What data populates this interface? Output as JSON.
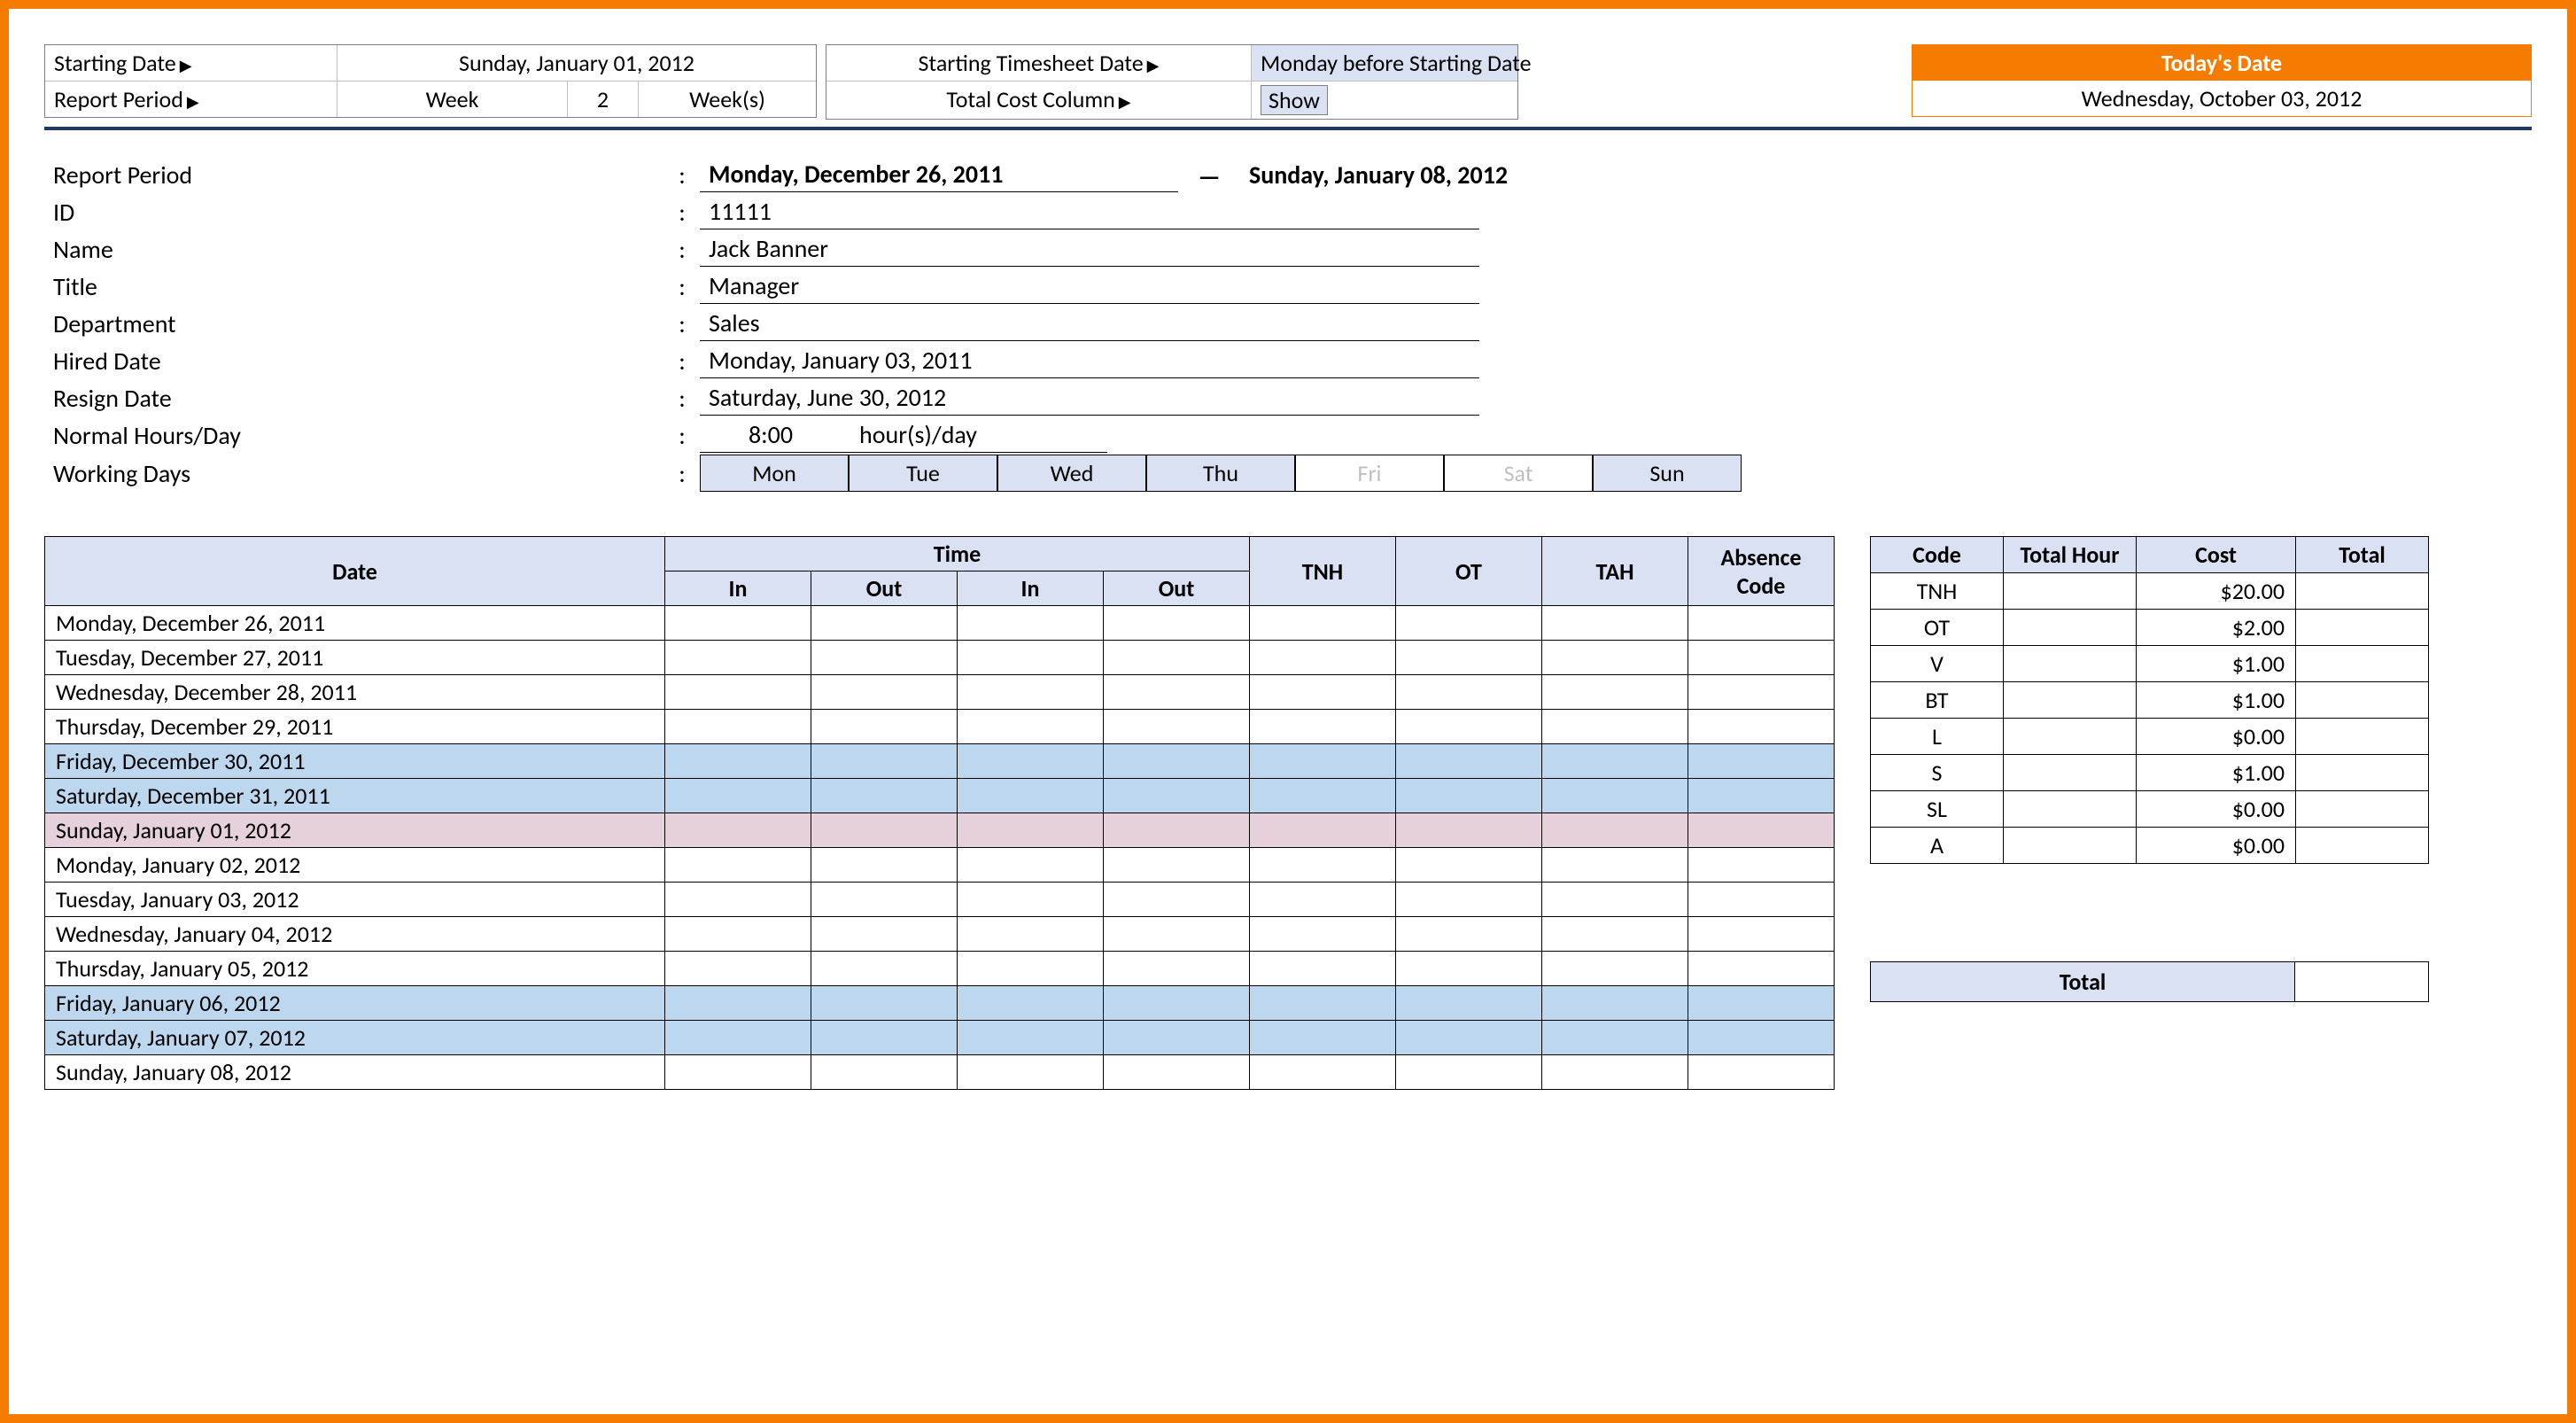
{
  "topbar": {
    "starting_date_label": "Starting Date",
    "starting_date_value": "Sunday, January 01, 2012",
    "report_period_label": "Report Period",
    "report_period_unit": "Week",
    "report_period_number": "2",
    "report_period_suffix": "Week(s)",
    "starting_ts_label": "Starting Timesheet Date",
    "starting_ts_value": "Monday before Starting Date",
    "total_cost_label": "Total Cost Column",
    "total_cost_value": "Show"
  },
  "today": {
    "heading": "Today's Date",
    "value": "Wednesday, October 03, 2012"
  },
  "info": {
    "report_period_lbl": "Report Period",
    "period_start": "Monday, December 26, 2011",
    "period_end": "Sunday, January 08, 2012",
    "id_lbl": "ID",
    "id_val": "11111",
    "name_lbl": "Name",
    "name_val": "Jack Banner",
    "title_lbl": "Title",
    "title_val": "Manager",
    "dept_lbl": "Department",
    "dept_val": "Sales",
    "hired_lbl": "Hired Date",
    "hired_val": "Monday, January 03, 2011",
    "resign_lbl": "Resign Date",
    "resign_val": "Saturday, June 30, 2012",
    "hours_lbl": "Normal Hours/Day",
    "hours_val": "8:00",
    "hours_suffix": "hour(s)/day",
    "days_lbl": "Working Days",
    "days": [
      "Mon",
      "Tue",
      "Wed",
      "Thu",
      "Fri",
      "Sat",
      "Sun"
    ],
    "days_off": [
      false,
      false,
      false,
      false,
      true,
      true,
      false
    ]
  },
  "timesheet": {
    "headers": {
      "date": "Date",
      "time": "Time",
      "in": "In",
      "out": "Out",
      "tnh": "TNH",
      "ot": "OT",
      "tah": "TAH",
      "abs": "Absence Code"
    },
    "rows": [
      {
        "date": "Monday, December 26, 2011",
        "cls": ""
      },
      {
        "date": "Tuesday, December 27, 2011",
        "cls": ""
      },
      {
        "date": "Wednesday, December 28, 2011",
        "cls": ""
      },
      {
        "date": "Thursday, December 29, 2011",
        "cls": ""
      },
      {
        "date": "Friday, December 30, 2011",
        "cls": "weekend"
      },
      {
        "date": "Saturday, December 31, 2011",
        "cls": "weekend"
      },
      {
        "date": "Sunday, January 01, 2012",
        "cls": "holiday"
      },
      {
        "date": "Monday, January 02, 2012",
        "cls": ""
      },
      {
        "date": "Tuesday, January 03, 2012",
        "cls": ""
      },
      {
        "date": "Wednesday, January 04, 2012",
        "cls": ""
      },
      {
        "date": "Thursday, January 05, 2012",
        "cls": ""
      },
      {
        "date": "Friday, January 06, 2012",
        "cls": "weekend"
      },
      {
        "date": "Saturday, January 07, 2012",
        "cls": "weekend"
      },
      {
        "date": "Sunday, January 08, 2012",
        "cls": ""
      }
    ]
  },
  "cost_table": {
    "headers": {
      "code": "Code",
      "total_hour": "Total Hour",
      "cost": "Cost",
      "total": "Total"
    },
    "rows": [
      {
        "code": "TNH",
        "cost": "$20.00"
      },
      {
        "code": "OT",
        "cost": "$2.00"
      },
      {
        "code": "V",
        "cost": "$1.00"
      },
      {
        "code": "BT",
        "cost": "$1.00"
      },
      {
        "code": "L",
        "cost": "$0.00"
      },
      {
        "code": "S",
        "cost": "$1.00"
      },
      {
        "code": "SL",
        "cost": "$0.00"
      },
      {
        "code": "A",
        "cost": "$0.00"
      }
    ],
    "total_label": "Total"
  }
}
